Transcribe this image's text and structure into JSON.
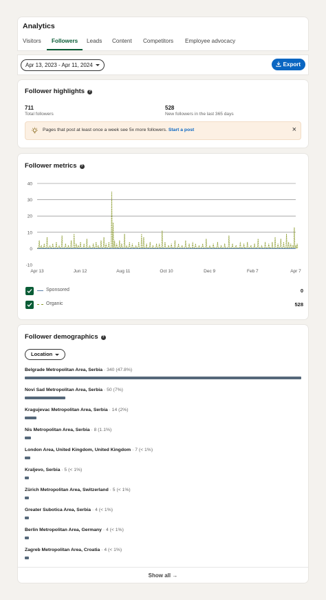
{
  "header": {
    "title": "Analytics",
    "tabs": [
      {
        "label": "Visitors"
      },
      {
        "label": "Followers"
      },
      {
        "label": "Leads"
      },
      {
        "label": "Content"
      },
      {
        "label": "Competitors"
      },
      {
        "label": "Employee advocacy"
      }
    ],
    "active_tab": "Followers"
  },
  "filter": {
    "date_range": "Apr 13, 2023 - Apr 11, 2024",
    "export_label": "Export"
  },
  "highlights": {
    "title": "Follower highlights",
    "total_value": "711",
    "total_label": "Total followers",
    "new_value": "528",
    "new_label": "New followers in the last 365 days",
    "banner_text": "Pages that post at least once a week see 5x more followers.",
    "banner_link": "Start a post",
    "close_icon": "×"
  },
  "metrics": {
    "title": "Follower metrics",
    "legend": [
      {
        "label": "Sponsored",
        "value": "0",
        "color": "#5a7fa8"
      },
      {
        "label": "Organic",
        "value": "528",
        "color": "#8a9a2a"
      }
    ]
  },
  "chart_data": {
    "type": "line",
    "ylim": [
      -10,
      40
    ],
    "yticks": [
      "40",
      "30",
      "20",
      "10",
      "0",
      "-10"
    ],
    "xticks": [
      "Apr 13",
      "Jun 12",
      "Aug 11",
      "Oct 10",
      "Dec 9",
      "Feb 7",
      "Apr 7"
    ],
    "series": [
      {
        "name": "Sponsored",
        "values": [
          0,
          0
        ]
      },
      {
        "name": "Organic",
        "peaks": [
          [
            3,
            5
          ],
          [
            6,
            2
          ],
          [
            10,
            3
          ],
          [
            14,
            7
          ],
          [
            18,
            2
          ],
          [
            22,
            3
          ],
          [
            27,
            4
          ],
          [
            31,
            2
          ],
          [
            35,
            8
          ],
          [
            40,
            3
          ],
          [
            44,
            2
          ],
          [
            48,
            5
          ],
          [
            52,
            9
          ],
          [
            55,
            3
          ],
          [
            58,
            2
          ],
          [
            61,
            4
          ],
          [
            66,
            3
          ],
          [
            70,
            6
          ],
          [
            74,
            2
          ],
          [
            79,
            3
          ],
          [
            83,
            4
          ],
          [
            86,
            2
          ],
          [
            90,
            5
          ],
          [
            94,
            7
          ],
          [
            97,
            3
          ],
          [
            101,
            4
          ],
          [
            105,
            35
          ],
          [
            107,
            16
          ],
          [
            109,
            5
          ],
          [
            112,
            3
          ],
          [
            116,
            5
          ],
          [
            119,
            3
          ],
          [
            123,
            9
          ],
          [
            126,
            2
          ],
          [
            130,
            4
          ],
          [
            134,
            3
          ],
          [
            139,
            2
          ],
          [
            143,
            4
          ],
          [
            147,
            9
          ],
          [
            150,
            7
          ],
          [
            154,
            3
          ],
          [
            159,
            4
          ],
          [
            163,
            2
          ],
          [
            168,
            3
          ],
          [
            172,
            3
          ],
          [
            176,
            11
          ],
          [
            180,
            4
          ],
          [
            185,
            2
          ],
          [
            189,
            3
          ],
          [
            194,
            5
          ],
          [
            199,
            3
          ],
          [
            204,
            2
          ],
          [
            209,
            5
          ],
          [
            214,
            3
          ],
          [
            219,
            4
          ],
          [
            223,
            3
          ],
          [
            228,
            2
          ],
          [
            233,
            3
          ],
          [
            238,
            6
          ],
          [
            243,
            2
          ],
          [
            248,
            3
          ],
          [
            254,
            4
          ],
          [
            259,
            2
          ],
          [
            264,
            3
          ],
          [
            270,
            8
          ],
          [
            275,
            3
          ],
          [
            280,
            2
          ],
          [
            286,
            4
          ],
          [
            291,
            3
          ],
          [
            296,
            4
          ],
          [
            301,
            2
          ],
          [
            306,
            3
          ],
          [
            311,
            6
          ],
          [
            316,
            2
          ],
          [
            321,
            4
          ],
          [
            326,
            3
          ],
          [
            331,
            4
          ],
          [
            335,
            7
          ],
          [
            339,
            3
          ],
          [
            343,
            6
          ],
          [
            347,
            4
          ],
          [
            351,
            9
          ],
          [
            354,
            4
          ],
          [
            357,
            3
          ],
          [
            360,
            2
          ],
          [
            362,
            13
          ],
          [
            364,
            2
          ],
          [
            366,
            3
          ]
        ]
      }
    ]
  },
  "demographics": {
    "title": "Follower demographics",
    "dropdown": "Location",
    "rows": [
      {
        "name": "Belgrade Metropolitan Area, Serbia",
        "stat": "· 340 (47.8%)",
        "pct": 47.8
      },
      {
        "name": "Novi Sad Metropolitan Area, Serbia",
        "stat": "· 50 (7%)",
        "pct": 7
      },
      {
        "name": "Kragujevac Metropolitan Area, Serbia",
        "stat": "· 14 (2%)",
        "pct": 2
      },
      {
        "name": "Nis Metropolitan Area, Serbia",
        "stat": "· 8 (1.1%)",
        "pct": 1.1
      },
      {
        "name": "London Area, United Kingdom, United Kingdom",
        "stat": "· 7 (< 1%)",
        "pct": 1.0
      },
      {
        "name": "Kraljevo, Serbia",
        "stat": "· 5 (< 1%)",
        "pct": 0.7
      },
      {
        "name": "Zürich Metropolitan Area, Switzerland",
        "stat": "· 5 (< 1%)",
        "pct": 0.7
      },
      {
        "name": "Greater Subotica Area, Serbia",
        "stat": "· 4 (< 1%)",
        "pct": 0.6
      },
      {
        "name": "Berlin Metropolitan Area, Germany",
        "stat": "· 4 (< 1%)",
        "pct": 0.6
      },
      {
        "name": "Zagreb Metropolitan Area, Croatia",
        "stat": "· 4 (< 1%)",
        "pct": 0.6
      }
    ],
    "show_all": "Show all →"
  }
}
